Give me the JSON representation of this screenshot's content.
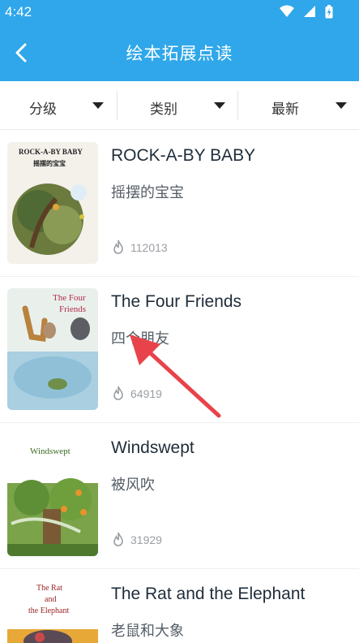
{
  "status": {
    "time": "4:42"
  },
  "header": {
    "title": "绘本拓展点读",
    "back_icon": "back-chevron-icon"
  },
  "filters": [
    {
      "label": "分级"
    },
    {
      "label": "类别"
    },
    {
      "label": "最新"
    }
  ],
  "books": [
    {
      "title": "ROCK-A-BY BABY",
      "subtitle": "摇摆的宝宝",
      "plays": "112013",
      "cover_title": "ROCK-A-BY BABY",
      "cover_subtitle": "摇摆的宝宝"
    },
    {
      "title": "The Four Friends",
      "subtitle": "四个朋友",
      "plays": "64919",
      "cover_title_1": "The Four",
      "cover_title_2": "Friends"
    },
    {
      "title": "Windswept",
      "subtitle": "被风吹",
      "plays": "31929",
      "cover_title": "Windswept"
    },
    {
      "title": "The Rat and the Elephant",
      "subtitle": "老鼠和大象",
      "plays": "",
      "cover_title_1": "The Rat",
      "cover_title_2": "and",
      "cover_title_3": "the Elephant"
    }
  ],
  "colors": {
    "appbar": "#2fa7ea",
    "annotation_arrow": "#e8434a"
  }
}
